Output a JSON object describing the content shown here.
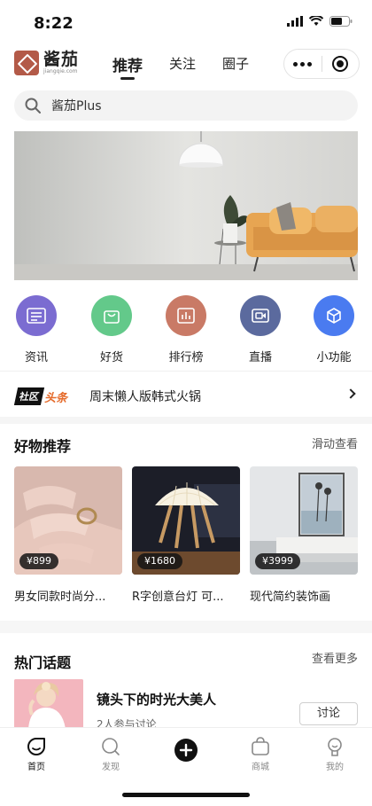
{
  "status_bar": {
    "time": "8:22"
  },
  "logo": {
    "name": "酱茄",
    "sub": "jiangqie.com"
  },
  "nav": {
    "tabs": [
      "推荐",
      "关注",
      "圈子"
    ],
    "active": "推荐"
  },
  "search": {
    "placeholder": "酱茄Plus"
  },
  "quick_links": [
    {
      "label": "资讯",
      "color": "#7b6cd1",
      "icon": "news-icon"
    },
    {
      "label": "好货",
      "color": "#63c98a",
      "icon": "bag-icon"
    },
    {
      "label": "排行榜",
      "color": "#c97a66",
      "icon": "chart-icon"
    },
    {
      "label": "直播",
      "color": "#5b6a9e",
      "icon": "live-icon"
    },
    {
      "label": "小功能",
      "color": "#4a7bf0",
      "icon": "cube-icon"
    }
  ],
  "headline": {
    "tag_a": "社区",
    "tag_b": "头条",
    "text": "周末懒人版韩式火锅"
  },
  "goods_section": {
    "title": "好物推荐",
    "link": "滑动查看"
  },
  "goods": [
    {
      "price": "¥899",
      "name": "男女同款时尚分..."
    },
    {
      "price": "¥1680",
      "name": "R字创意台灯 可..."
    },
    {
      "price": "¥3999",
      "name": "现代简约装饰画"
    }
  ],
  "topics_section": {
    "title": "热门话题",
    "link": "查看更多"
  },
  "topic": {
    "title": "镜头下的时光大美人",
    "sub": "2人参与讨论",
    "button": "讨论"
  },
  "tabbar": [
    {
      "label": "首页",
      "icon": "home-icon",
      "active": true
    },
    {
      "label": "发现",
      "icon": "discover-icon",
      "active": false
    },
    {
      "label": "",
      "icon": "publish-icon",
      "active": false
    },
    {
      "label": "商城",
      "icon": "shop-icon",
      "active": false
    },
    {
      "label": "我的",
      "icon": "profile-icon",
      "active": false
    }
  ],
  "colors": {
    "accent": "#111111",
    "logo": "#b35a48",
    "news_tag": "#e56a2a"
  }
}
